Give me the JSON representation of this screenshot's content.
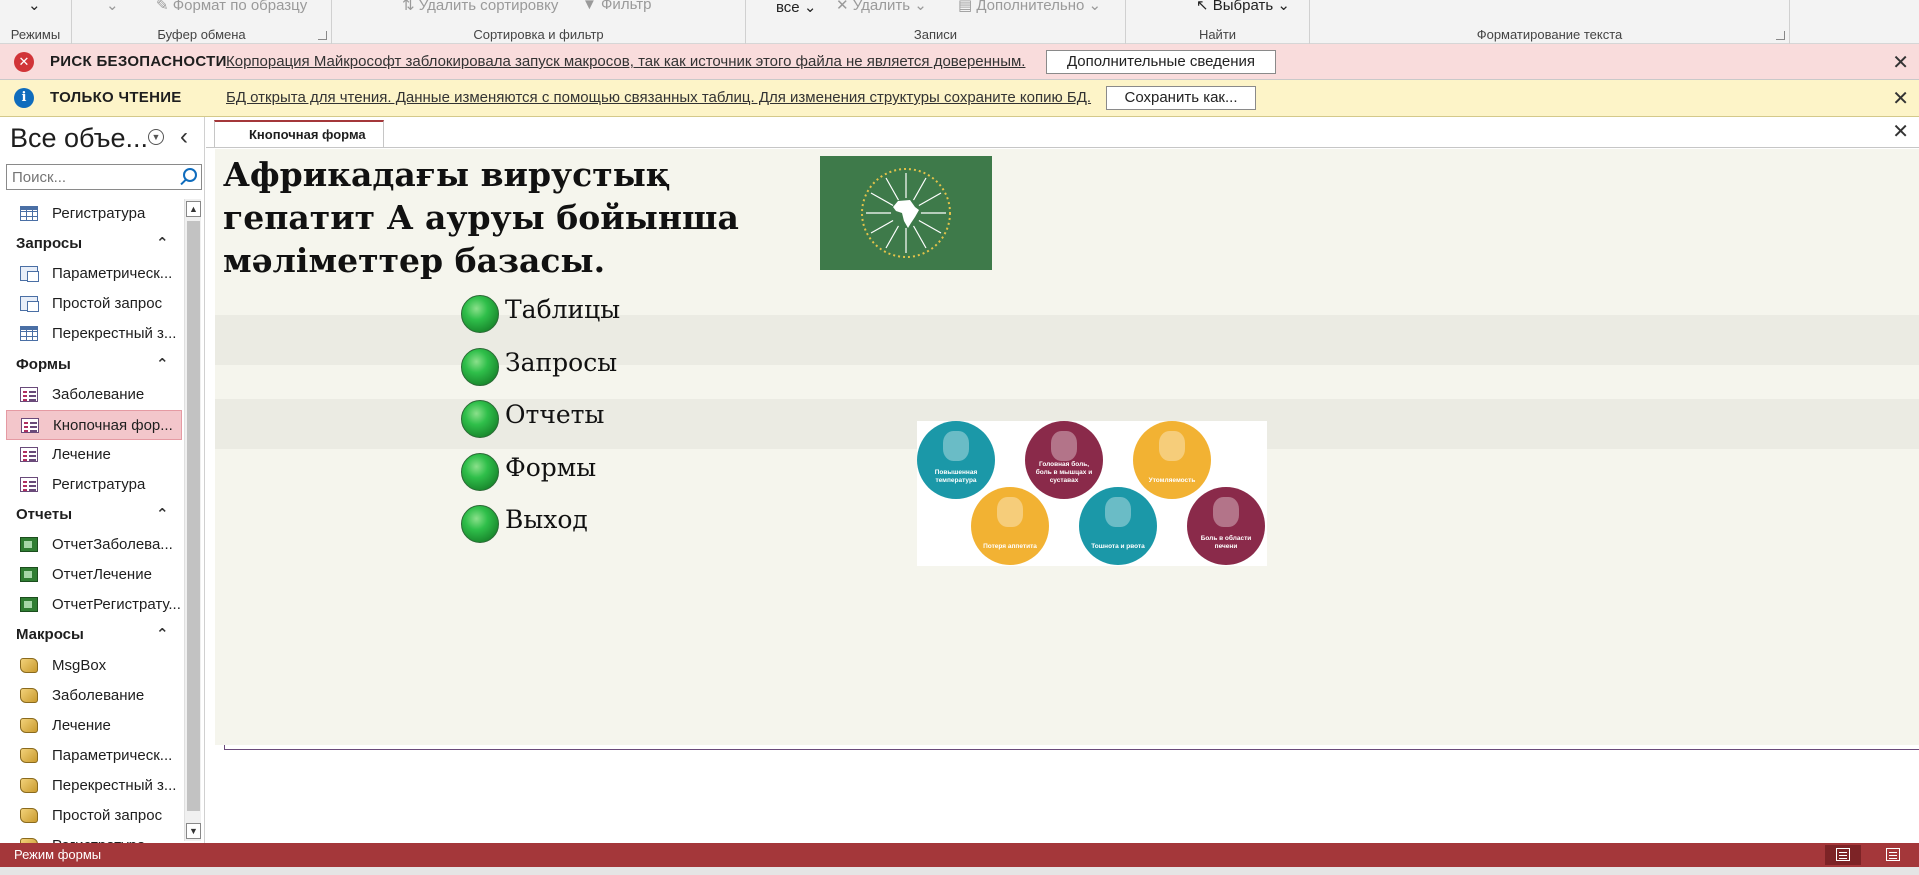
{
  "ribbon": {
    "groups": [
      {
        "label": "Режимы"
      },
      {
        "label": "Буфер обмена",
        "items": [
          "Формат по образцу"
        ]
      },
      {
        "label": "Сортировка и фильтр",
        "items": [
          "Удалить сортировку",
          "Фильтр"
        ]
      },
      {
        "label": "Записи",
        "items": [
          "все",
          "Удалить",
          "Дополнительно"
        ]
      },
      {
        "label": "Найти",
        "items": [
          "Выбрать"
        ]
      },
      {
        "label": "Форматирование текста"
      }
    ]
  },
  "security_bar": {
    "title": "РИСК БЕЗОПАСНОСТИ",
    "message": "Корпорация Майкрософт заблокировала запуск макросов, так как источник этого файла не является доверенным.",
    "button": "Дополнительные сведения",
    "icon": "x-circle-icon"
  },
  "readonly_bar": {
    "title": "ТОЛЬКО ЧТЕНИЕ",
    "message": "БД открыта для чтения. Данные изменяются с помощью связанных таблиц. Для изменения структуры сохраните копию БД.",
    "button": "Сохранить как...",
    "icon": "info-icon"
  },
  "nav": {
    "title": "Все объе...",
    "search_placeholder": "Поиск...",
    "rows": [
      {
        "kind": "item",
        "type": "table",
        "label": "Регистратура"
      },
      {
        "kind": "cat",
        "label": "Запросы"
      },
      {
        "kind": "item",
        "type": "query",
        "label": "Параметрическ..."
      },
      {
        "kind": "item",
        "type": "query",
        "label": "Простой запрос"
      },
      {
        "kind": "item",
        "type": "table",
        "label": "Перекрестный з..."
      },
      {
        "kind": "cat",
        "label": "Формы"
      },
      {
        "kind": "item",
        "type": "form",
        "label": "Заболевание"
      },
      {
        "kind": "item",
        "type": "form",
        "label": "Кнопочная фор...",
        "selected": true
      },
      {
        "kind": "item",
        "type": "form",
        "label": "Лечение"
      },
      {
        "kind": "item",
        "type": "form",
        "label": "Регистратура"
      },
      {
        "kind": "cat",
        "label": "Отчеты"
      },
      {
        "kind": "item",
        "type": "report",
        "label": "ОтчетЗаболева..."
      },
      {
        "kind": "item",
        "type": "report",
        "label": "ОтчетЛечение"
      },
      {
        "kind": "item",
        "type": "report",
        "label": "ОтчетРегистрату..."
      },
      {
        "kind": "cat",
        "label": "Макросы"
      },
      {
        "kind": "item",
        "type": "macro",
        "label": "MsgBox"
      },
      {
        "kind": "item",
        "type": "macro",
        "label": "Заболевание"
      },
      {
        "kind": "item",
        "type": "macro",
        "label": "Лечение"
      },
      {
        "kind": "item",
        "type": "macro",
        "label": "Параметрическ..."
      },
      {
        "kind": "item",
        "type": "macro",
        "label": "Перекрестный з..."
      },
      {
        "kind": "item",
        "type": "macro",
        "label": "Простой запрос"
      },
      {
        "kind": "item",
        "type": "macro",
        "label": "Регистратура"
      }
    ]
  },
  "document": {
    "tab_label": "Кнопочная форма",
    "form": {
      "title": "Африкадағы вирустық гепатит А  ауруы бойынша мәліметтер базасы.",
      "buttons": [
        "Таблицы",
        "Запросы",
        "Отчеты",
        "Формы",
        "Выход"
      ]
    },
    "symptoms": [
      {
        "label": "Повышенная температура",
        "color": "#1b98a8"
      },
      {
        "label": "Головная боль, боль в мышцах и суставах",
        "color": "#8a2a4a"
      },
      {
        "label": "Утомляемость",
        "color": "#f2b233"
      },
      {
        "label": "Потеря аппетита",
        "color": "#f2b233"
      },
      {
        "label": "Тошнота и рвота",
        "color": "#1b98a8"
      },
      {
        "label": "Боль в области печени",
        "color": "#8a2a4a"
      }
    ]
  },
  "status": {
    "mode": "Режим формы"
  },
  "colors": {
    "accent": "#a4373a",
    "security_bg": "#f9dcdc",
    "readonly_bg": "#fdf4c8",
    "form_bg": "#f5f5ed",
    "selected_bg": "#f3c6cb"
  }
}
